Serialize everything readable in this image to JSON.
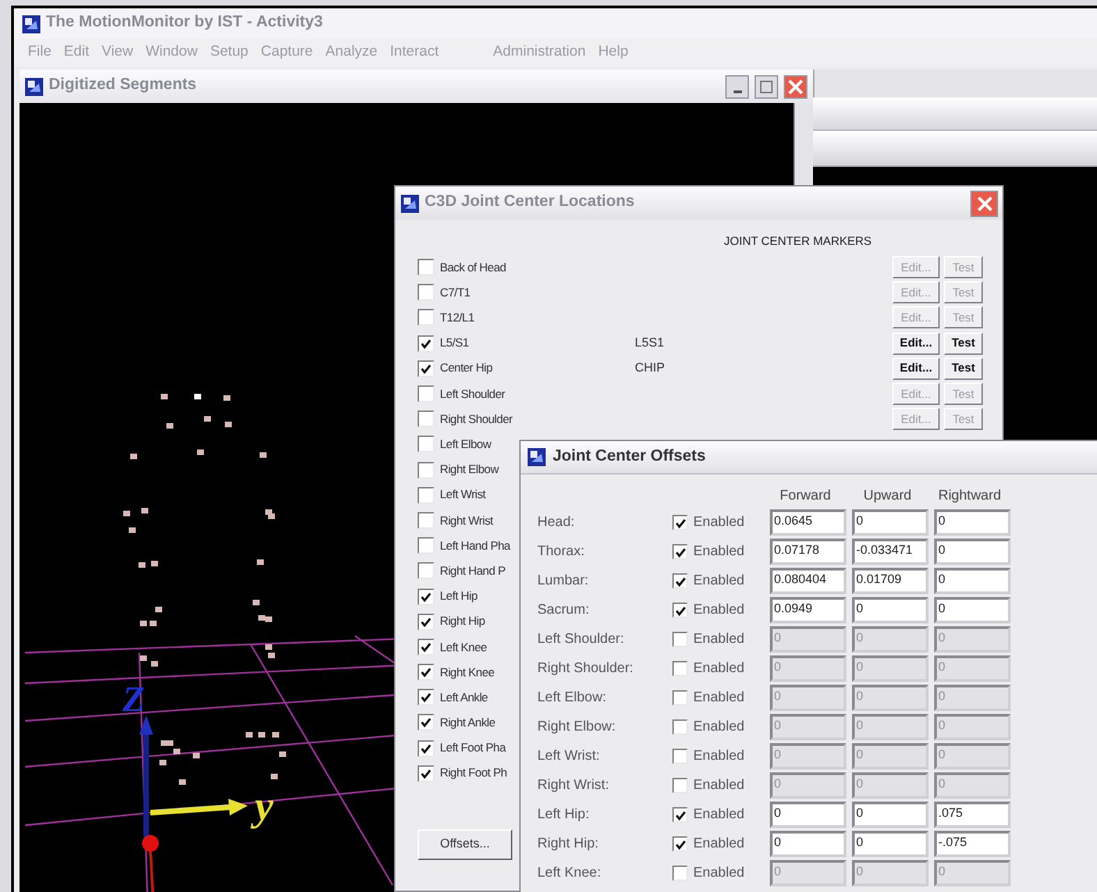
{
  "main_window": {
    "title": "The MotionMonitor by IST - Activity3",
    "menu": [
      "File",
      "Edit",
      "View",
      "Window",
      "Setup",
      "Capture",
      "Analyze",
      "Interact",
      "Administration",
      "Help"
    ]
  },
  "segments_window": {
    "title": "Digitized Segments",
    "axis_labels": [
      "Z",
      "y"
    ]
  },
  "c3d_dialog": {
    "title": "C3D Joint Center Locations",
    "column_header": "JOINT CENTER MARKERS",
    "offsets_button": "Offsets...",
    "rows": [
      {
        "label": "Back of Head",
        "checked": false,
        "edit_label": "Edit...",
        "test_label": "Test",
        "disabled": true
      },
      {
        "label": "C7/T1",
        "checked": false,
        "edit_label": "Edit...",
        "test_label": "Test",
        "disabled": true
      },
      {
        "label": "T12/L1",
        "checked": false,
        "edit_label": "Edit...",
        "test_label": "Test",
        "disabled": true
      },
      {
        "label": "L5/S1",
        "checked": true,
        "marker": "L5S1",
        "edit_label": "Edit...",
        "test_label": "Test",
        "disabled": false
      },
      {
        "label": "Center Hip",
        "checked": true,
        "marker": "CHIP",
        "edit_label": "Edit...",
        "test_label": "Test",
        "disabled": false
      },
      {
        "label": "Left Shoulder",
        "checked": false,
        "edit_label": "Edit...",
        "test_label": "Test",
        "disabled": true
      },
      {
        "label": "Right Shoulder",
        "checked": false,
        "edit_label": "Edit...",
        "test_label": "Test",
        "disabled": true
      },
      {
        "label": "Left Elbow",
        "checked": false
      },
      {
        "label": "Right Elbow",
        "checked": false
      },
      {
        "label": "Left Wrist",
        "checked": false
      },
      {
        "label": "Right Wrist",
        "checked": false
      },
      {
        "label": "Left Hand Pha",
        "checked": false
      },
      {
        "label": "Right Hand P",
        "checked": false
      },
      {
        "label": "Left Hip",
        "checked": true
      },
      {
        "label": "Right Hip",
        "checked": true
      },
      {
        "label": "Left Knee",
        "checked": true
      },
      {
        "label": "Right Knee",
        "checked": true
      },
      {
        "label": "Left Ankle",
        "checked": true
      },
      {
        "label": "Right Ankle",
        "checked": true
      },
      {
        "label": "Left Foot Pha",
        "checked": true
      },
      {
        "label": "Right Foot Ph",
        "checked": true
      }
    ]
  },
  "offsets_dialog": {
    "title": "Joint Center Offsets",
    "columns": [
      "Forward",
      "Upward",
      "Rightward"
    ],
    "rows": [
      {
        "label": "Head:",
        "enabled": true,
        "enabled_label": "Enabled",
        "values": [
          "0.0645",
          "0",
          "0"
        ]
      },
      {
        "label": "Thorax:",
        "enabled": true,
        "enabled_label": "Enabled",
        "values": [
          "0.07178",
          "-0.033471",
          "0"
        ]
      },
      {
        "label": "Lumbar:",
        "enabled": true,
        "enabled_label": "Enabled",
        "values": [
          "0.080404",
          "0.01709",
          "0"
        ]
      },
      {
        "label": "Sacrum:",
        "enabled": true,
        "enabled_label": "Enabled",
        "values": [
          "0.0949",
          "0",
          "0"
        ]
      },
      {
        "label": "Left Shoulder:",
        "enabled": false,
        "enabled_label": "Enabled",
        "values": [
          "0",
          "0",
          "0"
        ]
      },
      {
        "label": "Right Shoulder:",
        "enabled": false,
        "enabled_label": "Enabled",
        "values": [
          "0",
          "0",
          "0"
        ]
      },
      {
        "label": "Left Elbow:",
        "enabled": false,
        "enabled_label": "Enabled",
        "values": [
          "0",
          "0",
          "0"
        ]
      },
      {
        "label": "Right Elbow:",
        "enabled": false,
        "enabled_label": "Enabled",
        "values": [
          "0",
          "0",
          "0"
        ]
      },
      {
        "label": "Left Wrist:",
        "enabled": false,
        "enabled_label": "Enabled",
        "values": [
          "0",
          "0",
          "0"
        ]
      },
      {
        "label": "Right Wrist:",
        "enabled": false,
        "enabled_label": "Enabled",
        "values": [
          "0",
          "0",
          "0"
        ]
      },
      {
        "label": "Left Hip:",
        "enabled": true,
        "enabled_label": "Enabled",
        "values": [
          "0",
          "0",
          ".075"
        ]
      },
      {
        "label": "Right Hip:",
        "enabled": true,
        "enabled_label": "Enabled",
        "values": [
          "0",
          "0",
          "-.075"
        ]
      },
      {
        "label": "Left Knee:",
        "enabled": false,
        "enabled_label": "Enabled",
        "values": [
          "0",
          "0",
          "0"
        ]
      }
    ]
  }
}
